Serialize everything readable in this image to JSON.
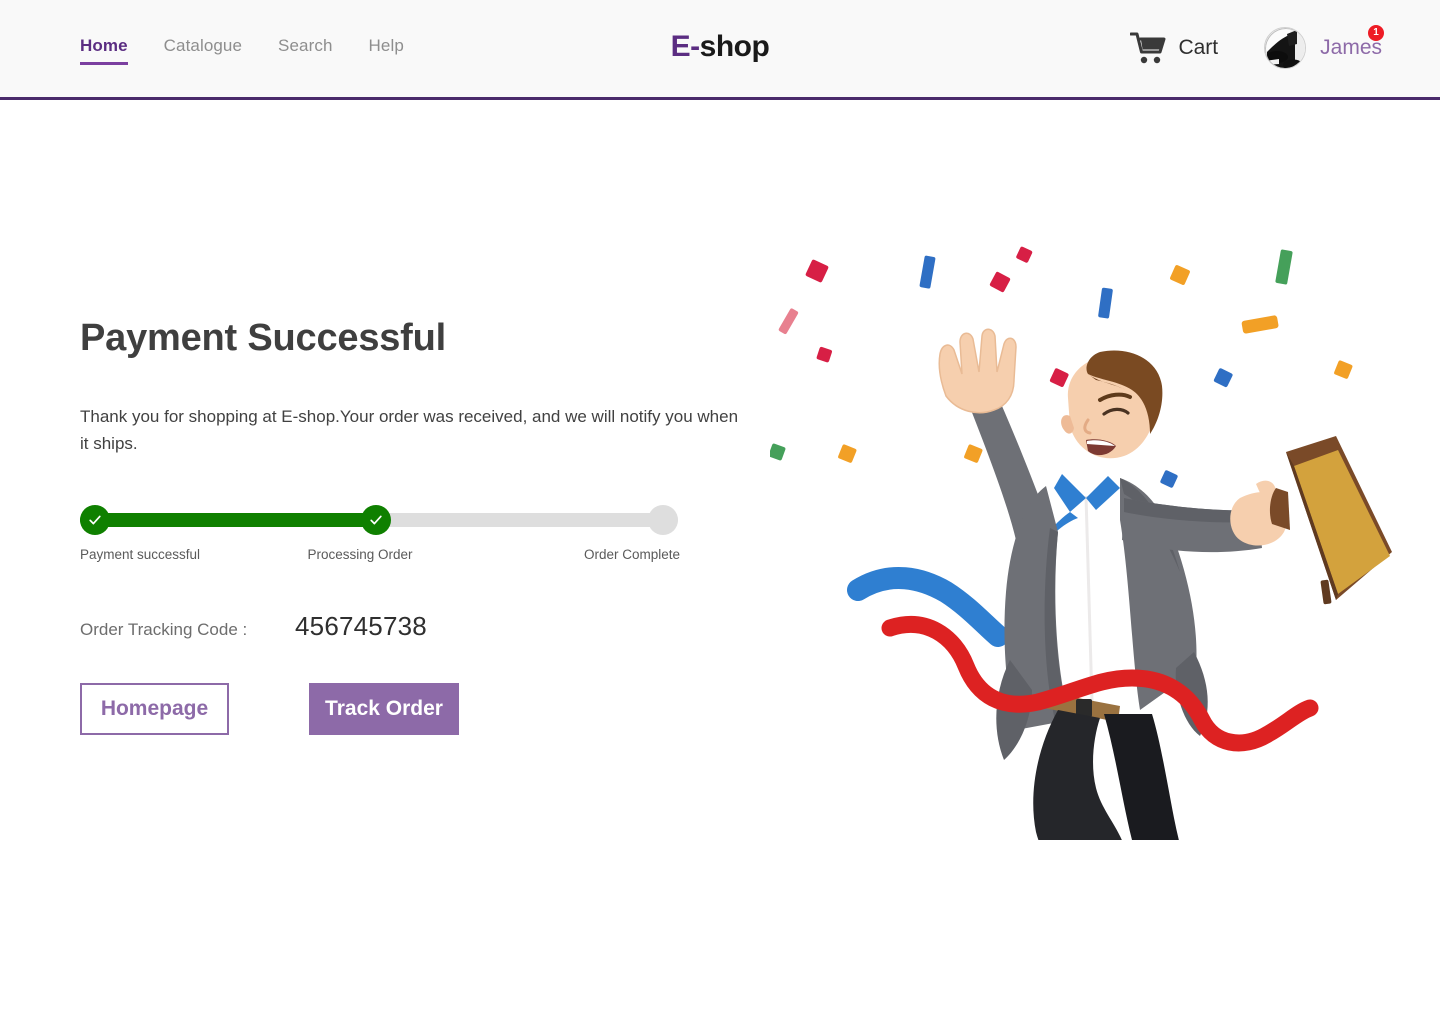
{
  "header": {
    "nav": [
      {
        "label": "Home",
        "active": true
      },
      {
        "label": "Catalogue",
        "active": false
      },
      {
        "label": "Search",
        "active": false
      },
      {
        "label": "Help",
        "active": false
      }
    ],
    "logo": {
      "prefix": "E-",
      "suffix": "shop"
    },
    "cart": {
      "label": "Cart",
      "badge": "1",
      "icon": "shopping-cart-icon"
    },
    "user": {
      "name": "James",
      "avatar_icon": "user-avatar-photo"
    },
    "accent_color": "#5b2d82",
    "border_color": "#4a2a6b",
    "badge_color": "#ee1c25",
    "background": "#f9f9f9"
  },
  "main": {
    "title": "Payment Successful",
    "message": "Thank you for shopping at E-shop.Your order was received, and we will notify you when it ships.",
    "stepper": {
      "steps": [
        {
          "label": "Payment successful",
          "state": "done"
        },
        {
          "label": "Processing Order",
          "state": "done"
        },
        {
          "label": "Order Complete",
          "state": "todo"
        }
      ],
      "done_color": "#0f8000",
      "todo_color": "#dedede",
      "check_icon": "check-icon"
    },
    "tracking": {
      "label": "Order Tracking Code :",
      "value": "456745738"
    },
    "buttons": {
      "homepage": "Homepage",
      "track_order": "Track Order",
      "purple": "#8d6aa8"
    },
    "illustration": {
      "name": "celebrating-businessman-illustration",
      "description": "Man in grey suit jumping with briefcase through red finish-line ribbon, surrounded by confetti",
      "colors": {
        "suit": "#6e7076",
        "shirt": "#ffffff",
        "tie": "#2f7fd1",
        "skin": "#f2c6a3",
        "hair": "#7a4a22",
        "trousers": "#25262a",
        "shoes": "#b8541f",
        "briefcase": "#d3a23d",
        "briefcase_edge": "#7a4a28",
        "ribbon": "#dd2222",
        "confetti_red": "#d71f45",
        "confetti_blue": "#2f6fc4",
        "confetti_orange": "#f2a026",
        "confetti_green": "#45a05a",
        "confetti_pink": "#e8808f"
      }
    }
  }
}
